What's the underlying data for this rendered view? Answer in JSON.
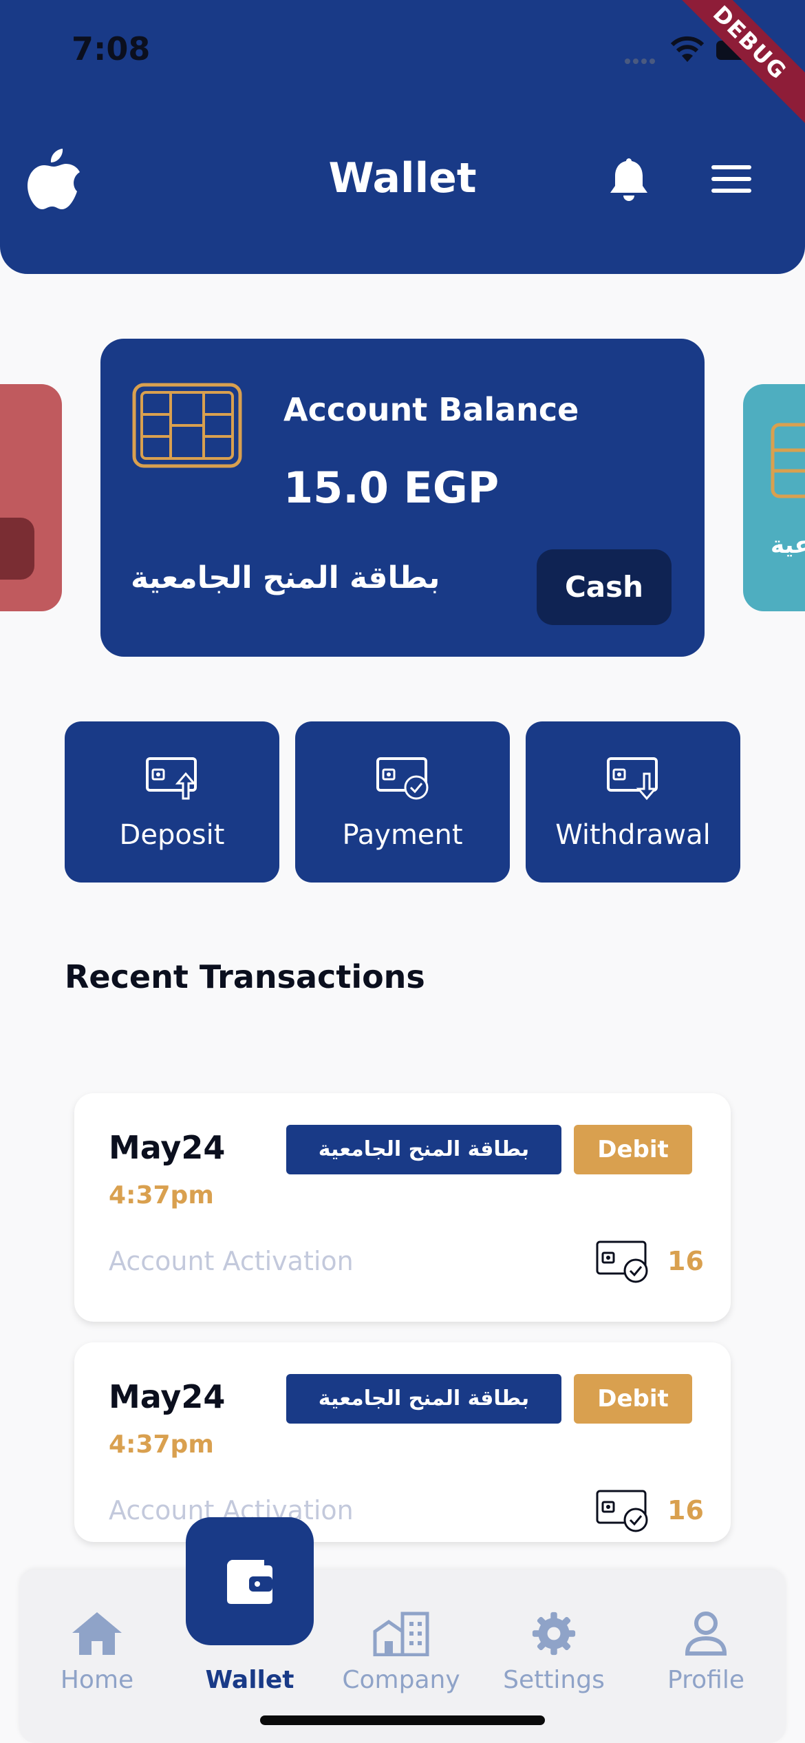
{
  "status_bar": {
    "time": "7:08",
    "debug": "DEBUG"
  },
  "header": {
    "title": "Wallet",
    "left_icon": "apple-icon",
    "right_icons": [
      "bell-icon",
      "menu-icon"
    ]
  },
  "cards": {
    "right_partial_text": "عية",
    "main": {
      "label": "Account Balance",
      "balance": "15.0 EGP",
      "name": "بطاقة المنح الجامعية",
      "type_button": "Cash"
    }
  },
  "actions": [
    {
      "label": "Deposit",
      "icon": "card-deposit-icon"
    },
    {
      "label": "Payment",
      "icon": "card-payment-icon"
    },
    {
      "label": "Withdrawal",
      "icon": "card-withdrawal-icon"
    }
  ],
  "transactions": {
    "title": "Recent Transactions",
    "items": [
      {
        "date": "May24",
        "time": "4:37pm",
        "card": "بطاقة المنح الجامعية",
        "type": "Debit",
        "description": "Account Activation",
        "amount": "16"
      },
      {
        "date": "May24",
        "time": "4:37pm",
        "card": "بطاقة المنح الجامعية",
        "type": "Debit",
        "description": "Account Activation",
        "amount": "16"
      }
    ]
  },
  "bottom_nav": {
    "active": "Wallet",
    "items": [
      {
        "label": "Home",
        "icon": "home-icon"
      },
      {
        "label": "Wallet",
        "icon": "wallet-icon"
      },
      {
        "label": "Company",
        "icon": "company-icon"
      },
      {
        "label": "Settings",
        "icon": "gear-icon"
      },
      {
        "label": "Profile",
        "icon": "profile-icon"
      }
    ]
  },
  "colors": {
    "primary": "#193a87",
    "accent": "#d9a04f",
    "background": "#f9f9fa",
    "card_red": "#c05a5e",
    "card_teal": "#4eaec0"
  }
}
